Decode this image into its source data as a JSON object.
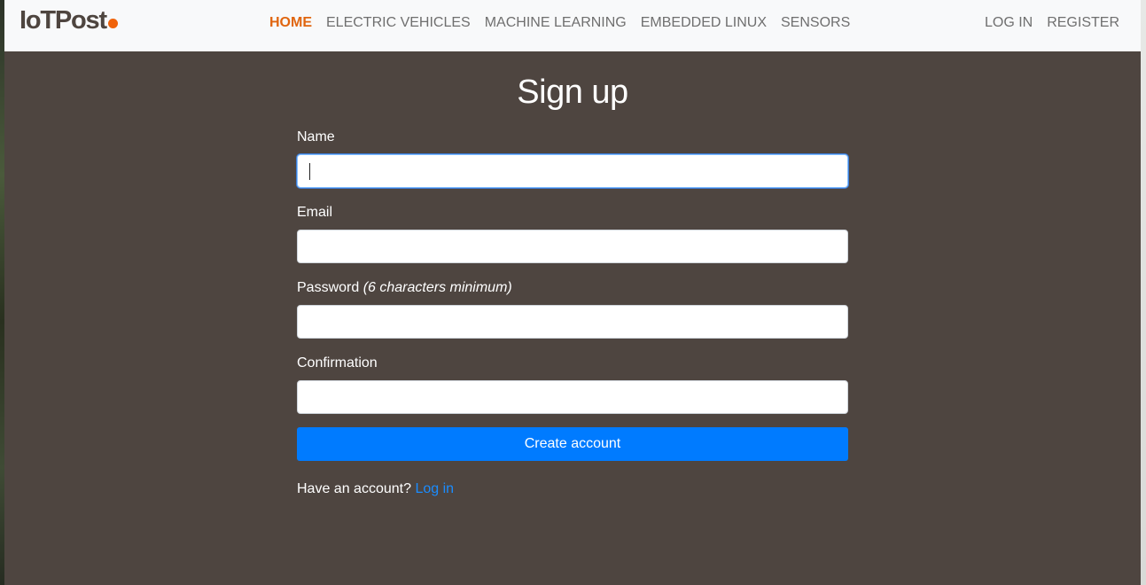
{
  "navbar": {
    "brand": "IoTPost",
    "links": [
      "HOME",
      "ELECTRIC VEHICLES",
      "MACHINE LEARNING",
      "EMBEDDED LINUX",
      "SENSORS"
    ],
    "active_link": "HOME",
    "right_links": [
      "LOG IN",
      "REGISTER"
    ]
  },
  "form": {
    "title": "Sign up",
    "name_label": "Name",
    "name_value": "",
    "email_label": "Email",
    "email_value": "",
    "password_label": "Password",
    "password_hint": "(6 characters minimum)",
    "password_value": "",
    "confirmation_label": "Confirmation",
    "confirmation_value": "",
    "submit_label": "Create account",
    "footer_text": "Have an account?",
    "footer_link": "Log in"
  },
  "colors": {
    "navbar_bg": "#f8f9fa",
    "page_bg": "#4e4540",
    "active_link": "#e0650f",
    "brand_dot": "#f0630a",
    "primary_button": "#007bff",
    "link": "#1a8cff"
  }
}
